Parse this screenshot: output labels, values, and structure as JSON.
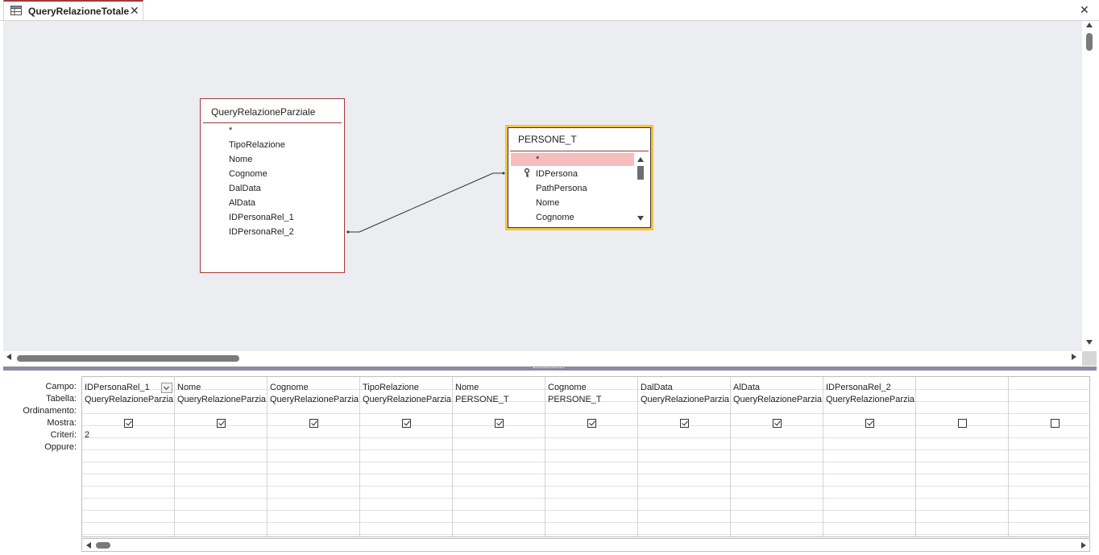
{
  "tab": {
    "title": "QueryRelazioneTotale",
    "close": "✕"
  },
  "window": {
    "close": "✕"
  },
  "tables": [
    {
      "title": "QueryRelazioneParziale",
      "fields": [
        "*",
        "TipoRelazione",
        "Nome",
        "Cognome",
        "DalData",
        "AlData",
        "IDPersonaRel_1",
        "IDPersonaRel_2"
      ]
    },
    {
      "title": "PERSONE_T",
      "fields": [
        "*",
        "IDPersona",
        "PathPersona",
        "Nome",
        "Cognome"
      ],
      "key_field": "IDPersona"
    }
  ],
  "grid": {
    "row_labels": {
      "campo": "Campo:",
      "tabella": "Tabella:",
      "ordinamento": "Ordinamento:",
      "mostra": "Mostra:",
      "criteri": "Criteri:",
      "oppure": "Oppure:"
    },
    "columns": [
      {
        "campo": "IDPersonaRel_1",
        "tabella": "QueryRelazioneParziale",
        "mostra": true,
        "criteri": "2"
      },
      {
        "campo": "Nome",
        "tabella": "QueryRelazioneParziale",
        "mostra": true,
        "criteri": ""
      },
      {
        "campo": "Cognome",
        "tabella": "QueryRelazioneParziale",
        "mostra": true,
        "criteri": ""
      },
      {
        "campo": "TipoRelazione",
        "tabella": "QueryRelazioneParziale",
        "mostra": true,
        "criteri": ""
      },
      {
        "campo": "Nome",
        "tabella": "PERSONE_T",
        "mostra": true,
        "criteri": ""
      },
      {
        "campo": "Cognome",
        "tabella": "PERSONE_T",
        "mostra": true,
        "criteri": ""
      },
      {
        "campo": "DalData",
        "tabella": "QueryRelazioneParziale",
        "mostra": true,
        "criteri": ""
      },
      {
        "campo": "AlData",
        "tabella": "QueryRelazioneParziale",
        "mostra": true,
        "criteri": ""
      },
      {
        "campo": "IDPersonaRel_2",
        "tabella": "QueryRelazioneParziale",
        "mostra": true,
        "criteri": ""
      },
      {
        "campo": "",
        "tabella": "",
        "mostra": false,
        "criteri": ""
      },
      {
        "campo": "",
        "tabella": "",
        "mostra": false,
        "criteri": ""
      }
    ]
  },
  "colors": {
    "accent": "#a4373a",
    "selected_table_border": "#f5c242",
    "selected_row": "#f7bcbc",
    "canvas": "#ebedf0"
  }
}
